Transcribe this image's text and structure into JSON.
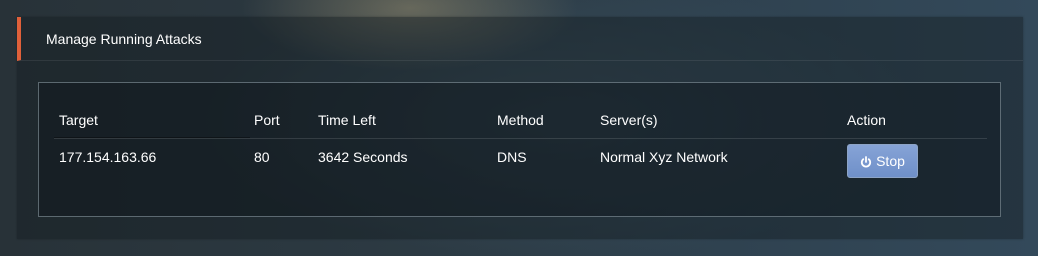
{
  "panel": {
    "title": "Manage Running Attacks",
    "accent_color": "#e0603a"
  },
  "table": {
    "headers": [
      "Target",
      "Port",
      "Time Left",
      "Method",
      "Server(s)",
      "Action"
    ],
    "rows": [
      {
        "target": "177.154.163.66",
        "port": "80",
        "time_left": "3642 Seconds",
        "method": "DNS",
        "servers": "Normal Xyz Network",
        "action": {
          "label": "Stop",
          "icon": "power-icon",
          "color": "#7795cd"
        }
      }
    ]
  }
}
